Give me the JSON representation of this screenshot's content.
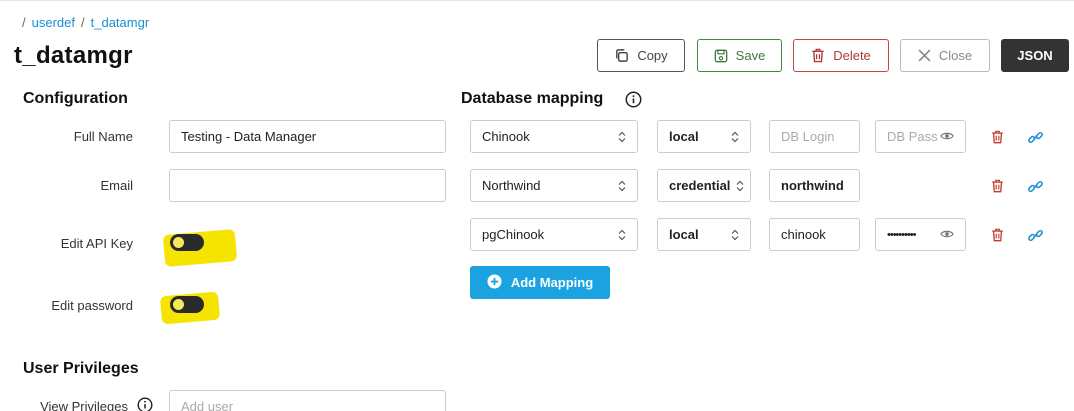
{
  "breadcrumb": {
    "sep": "/",
    "items": [
      "userdef",
      "t_datamgr"
    ]
  },
  "page": {
    "title": "t_datamgr"
  },
  "toolbar": {
    "copy": "Copy",
    "save": "Save",
    "delete": "Delete",
    "close": "Close",
    "json": "JSON"
  },
  "configuration": {
    "title": "Configuration",
    "full_name": {
      "label": "Full Name",
      "value": "Testing - Data Manager"
    },
    "email": {
      "label": "Email",
      "value": ""
    },
    "edit_api_key": {
      "label": "Edit API Key",
      "on": false
    },
    "edit_password": {
      "label": "Edit password",
      "on": false
    }
  },
  "privileges": {
    "title": "User Privileges",
    "view_label": "View Privileges",
    "view_placeholder": "Add user"
  },
  "mapping": {
    "title": "Database mapping",
    "rows": [
      {
        "database": "Chinook",
        "type": "local",
        "login": "",
        "login_placeholder": "DB Login",
        "password": "",
        "password_placeholder": "DB Pass",
        "show_password_field": true
      },
      {
        "database": "Northwind",
        "type": "credential",
        "login": "northwind",
        "login_placeholder": "DB Login",
        "show_password_field": false
      },
      {
        "database": "pgChinook",
        "type": "local",
        "login": "chinook",
        "login_placeholder": "DB Login",
        "password": "••••••••••",
        "show_password_field": true
      }
    ],
    "add_label": "Add Mapping"
  },
  "colors": {
    "accent": "#1aa3e0",
    "link": "#1a8fd1",
    "highlight": "#f5e400",
    "danger": "#c0392b",
    "success": "#3c8c3c"
  }
}
